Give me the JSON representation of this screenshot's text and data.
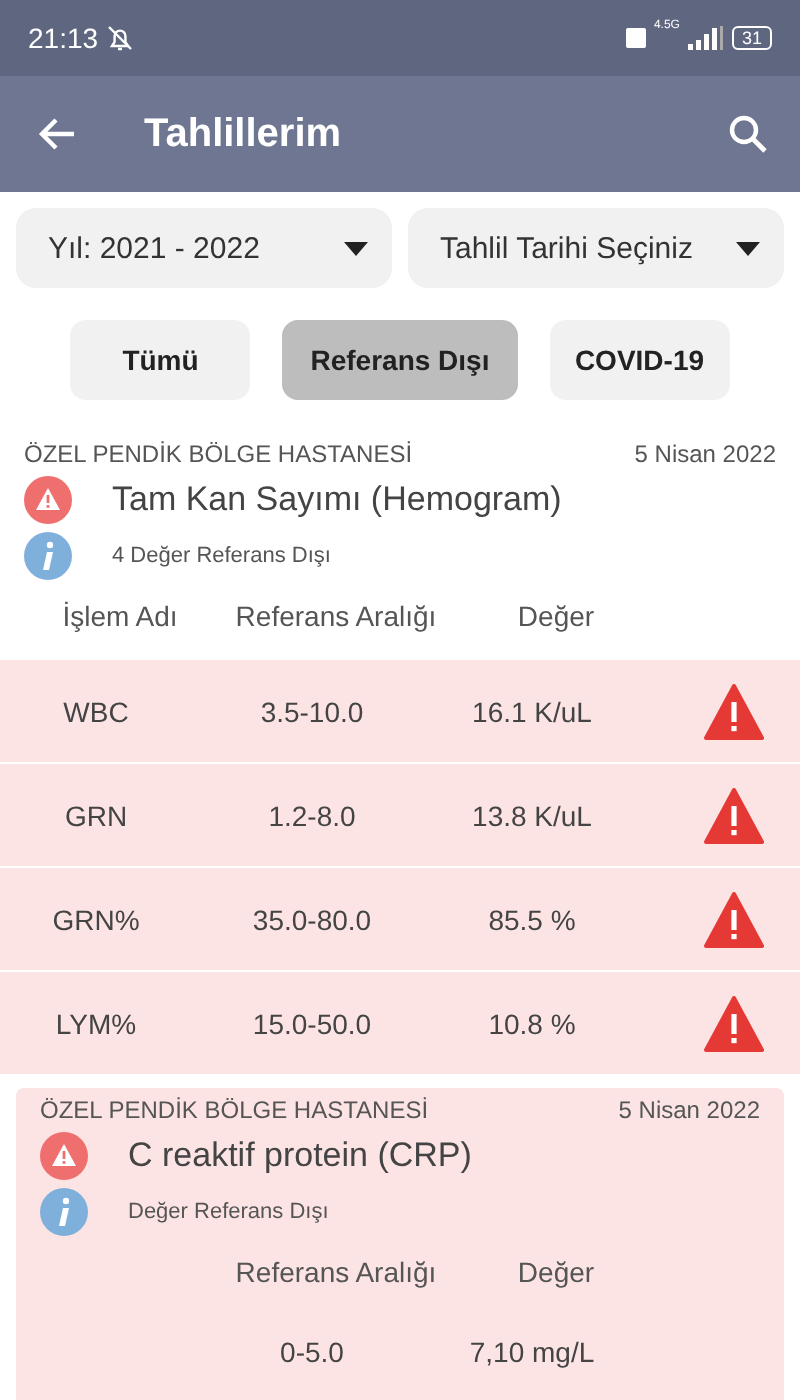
{
  "status_bar": {
    "time": "21:13",
    "network": "4.5G",
    "battery": "31"
  },
  "app_bar": {
    "title": "Tahlillerim"
  },
  "filters": [
    {
      "label": "Yıl: 2021 - 2022"
    },
    {
      "label": "Tahlil Tarihi Seçiniz"
    }
  ],
  "tabs": [
    {
      "label": "Tümü",
      "selected": false
    },
    {
      "label": "Referans Dışı",
      "selected": true
    },
    {
      "label": "COVID-19",
      "selected": false
    }
  ],
  "cards": [
    {
      "kind": "split",
      "hospital": "ÖZEL PENDİK BÖLGE HASTANESİ",
      "date": "5 Nisan 2022",
      "title": "Tam Kan Sayımı (Hemogram)",
      "note": "4 Değer Referans Dışı",
      "columns": [
        {
          "kind": "name",
          "label": "İşlem Adı"
        },
        {
          "kind": "range",
          "label": "Referans Aralığı"
        },
        {
          "kind": "value",
          "label": "Değer"
        }
      ],
      "rows": [
        {
          "name": "WBC",
          "range": "3.5-10.0",
          "value": "16.1 K/uL",
          "alert": true
        },
        {
          "name": "GRN",
          "range": "1.2-8.0",
          "value": "13.8 K/uL",
          "alert": true
        },
        {
          "name": "GRN%",
          "range": "35.0-80.0",
          "value": "85.5 %",
          "alert": true
        },
        {
          "name": "LYM%",
          "range": "15.0-50.0",
          "value": "10.8 %",
          "alert": true
        }
      ]
    },
    {
      "kind": "boxed",
      "hospital": "ÖZEL PENDİK BÖLGE HASTANESİ",
      "date": "5 Nisan 2022",
      "title": "C reaktif protein (CRP)",
      "note": "Değer Referans Dışı",
      "columns": [
        {
          "kind": "range",
          "label": "Referans Aralığı"
        },
        {
          "kind": "value",
          "label": "Değer"
        }
      ],
      "rows": [
        {
          "range": "0-5.0",
          "value": "7,10 mg/L",
          "alert": false
        }
      ]
    }
  ]
}
